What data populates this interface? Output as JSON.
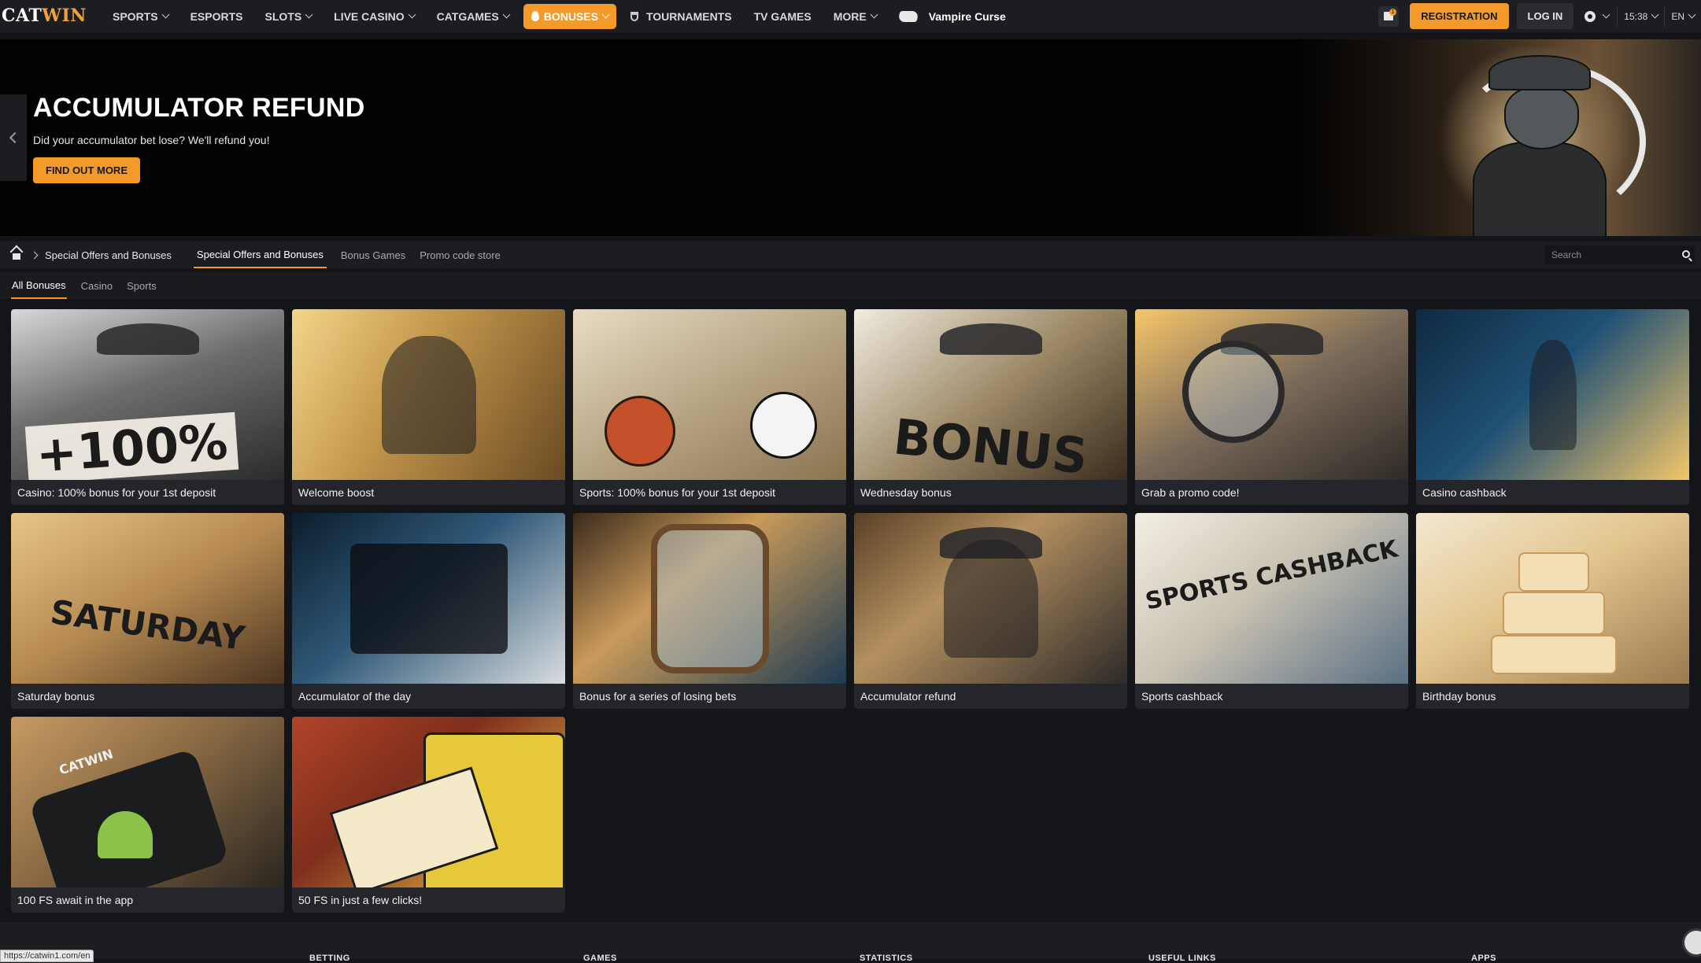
{
  "header": {
    "logo": {
      "part1": "CAT",
      "part2": "WIN"
    },
    "nav": [
      {
        "label": "SPORTS",
        "dropdown": true
      },
      {
        "label": "ESPORTS",
        "dropdown": false
      },
      {
        "label": "SLOTS",
        "dropdown": true
      },
      {
        "label": "LIVE CASINO",
        "dropdown": true
      },
      {
        "label": "CATGAMES",
        "dropdown": true
      },
      {
        "label": "BONUSES",
        "dropdown": true,
        "active": true
      },
      {
        "label": "TOURNAMENTS",
        "dropdown": false
      },
      {
        "label": "TV GAMES",
        "dropdown": false
      },
      {
        "label": "MORE",
        "dropdown": true
      }
    ],
    "featured_game": "Vampire Curse",
    "gift_badge": "1",
    "registration_label": "REGISTRATION",
    "login_label": "LOG IN",
    "time": "15:38",
    "language": "EN"
  },
  "banner": {
    "title": "ACCUMULATOR REFUND",
    "subtitle": "Did your accumulator bet lose? We'll refund you!",
    "cta": "FIND OUT MORE"
  },
  "subnav": {
    "breadcrumb": "Special Offers and Bonuses",
    "tabs": [
      "Special Offers and Bonuses",
      "Bonus Games",
      "Promo code store"
    ],
    "active_tab": "Special Offers and Bonuses",
    "search_placeholder": "Search"
  },
  "filters": {
    "items": [
      "All Bonuses",
      "Casino",
      "Sports"
    ],
    "active": "All Bonuses"
  },
  "cards": [
    {
      "title": "Casino: 100% bonus for your 1st deposit",
      "image_text": "+100%"
    },
    {
      "title": "Welcome boost"
    },
    {
      "title": "Sports: 100% bonus for your 1st deposit"
    },
    {
      "title": "Wednesday bonus",
      "image_text": "BONUS"
    },
    {
      "title": "Grab a promo code!"
    },
    {
      "title": "Casino cashback"
    },
    {
      "title": "Saturday bonus",
      "image_text": "SATURDAY"
    },
    {
      "title": "Accumulator of the day"
    },
    {
      "title": "Bonus for a series of losing bets"
    },
    {
      "title": "Accumulator refund"
    },
    {
      "title": "Sports cashback",
      "image_text": "SPORTS CASHBACK"
    },
    {
      "title": "Birthday bonus"
    },
    {
      "title": "100 FS await in the app",
      "image_text": "CATWIN"
    },
    {
      "title": "50 FS in just a few clicks!"
    }
  ],
  "footer": {
    "columns": [
      "BETTING",
      "GAMES",
      "STATISTICS",
      "USEFUL LINKS",
      "APPS"
    ],
    "status_url": "https://catwin1.com/en"
  },
  "colors": {
    "accent": "#f39a2b",
    "background": "#141518",
    "panel": "#1c1d21",
    "card": "#25262b"
  }
}
